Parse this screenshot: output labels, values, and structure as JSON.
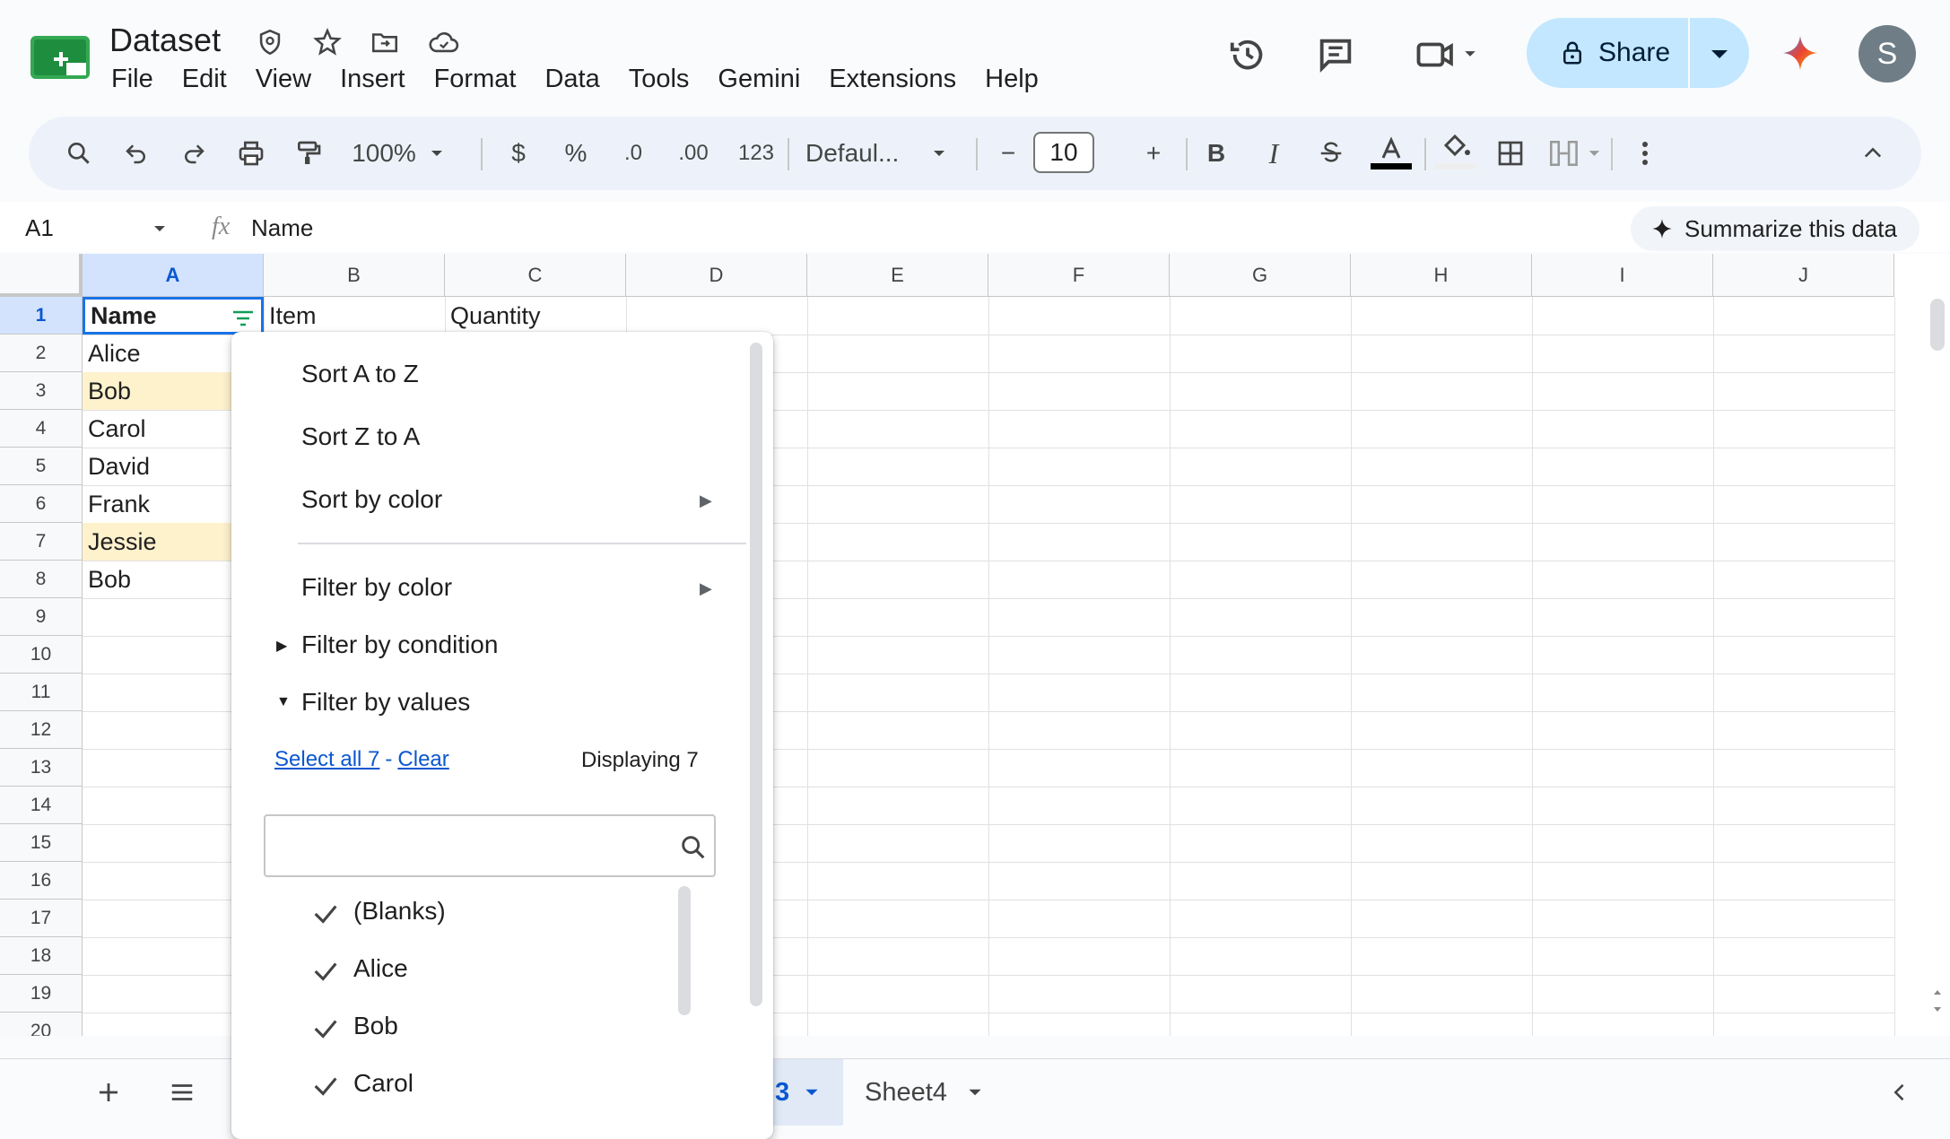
{
  "doc": {
    "title": "Dataset"
  },
  "menu": [
    "File",
    "Edit",
    "View",
    "Insert",
    "Format",
    "Data",
    "Tools",
    "Gemini",
    "Extensions",
    "Help"
  ],
  "share": {
    "label": "Share"
  },
  "avatar": {
    "initial": "S"
  },
  "toolbar": {
    "zoom": "100%",
    "currency": "$",
    "percent": "%",
    "dec_dec": ".0",
    "inc_dec": ".00",
    "format_123": "123",
    "font": "Defaul...",
    "font_size": "10",
    "minus": "−",
    "plus": "+",
    "bold": "B",
    "italic": "I"
  },
  "formula_bar": {
    "cell_ref": "A1",
    "fx": "fx",
    "value": "Name",
    "summarize": "Summarize this data"
  },
  "columns": [
    "A",
    "B",
    "C",
    "D",
    "E",
    "F",
    "G",
    "H",
    "I",
    "J"
  ],
  "rows": [
    "1",
    "2",
    "3",
    "4",
    "5",
    "6",
    "7",
    "8",
    "9",
    "10",
    "11",
    "12",
    "13",
    "14",
    "15",
    "16",
    "17",
    "18",
    "19",
    "20"
  ],
  "cells": {
    "A1": "Name",
    "B1": "Item",
    "C1": "Quantity",
    "A2": "Alice",
    "A3": "Bob",
    "A4": "Carol",
    "A5": "David",
    "A6": "Frank",
    "A7": "Jessie",
    "A8": "Bob"
  },
  "filter_menu": {
    "sort_az": "Sort A to Z",
    "sort_za": "Sort Z to A",
    "sort_color": "Sort by color",
    "filter_color": "Filter by color",
    "filter_condition": "Filter by condition",
    "filter_values": "Filter by values",
    "select_all": "Select all 7",
    "dash": "-",
    "clear": "Clear",
    "displaying": "Displaying 7",
    "search_placeholder": "",
    "values": [
      "(Blanks)",
      "Alice",
      "Bob",
      "Carol"
    ]
  },
  "sheets": {
    "active_partial": "3",
    "other": "Sheet4"
  },
  "colors": {
    "accent": "#0b57d0",
    "share_bg": "#c2e7ff",
    "highlight": "#fef2cd",
    "selected_header": "#d3e3fd"
  }
}
